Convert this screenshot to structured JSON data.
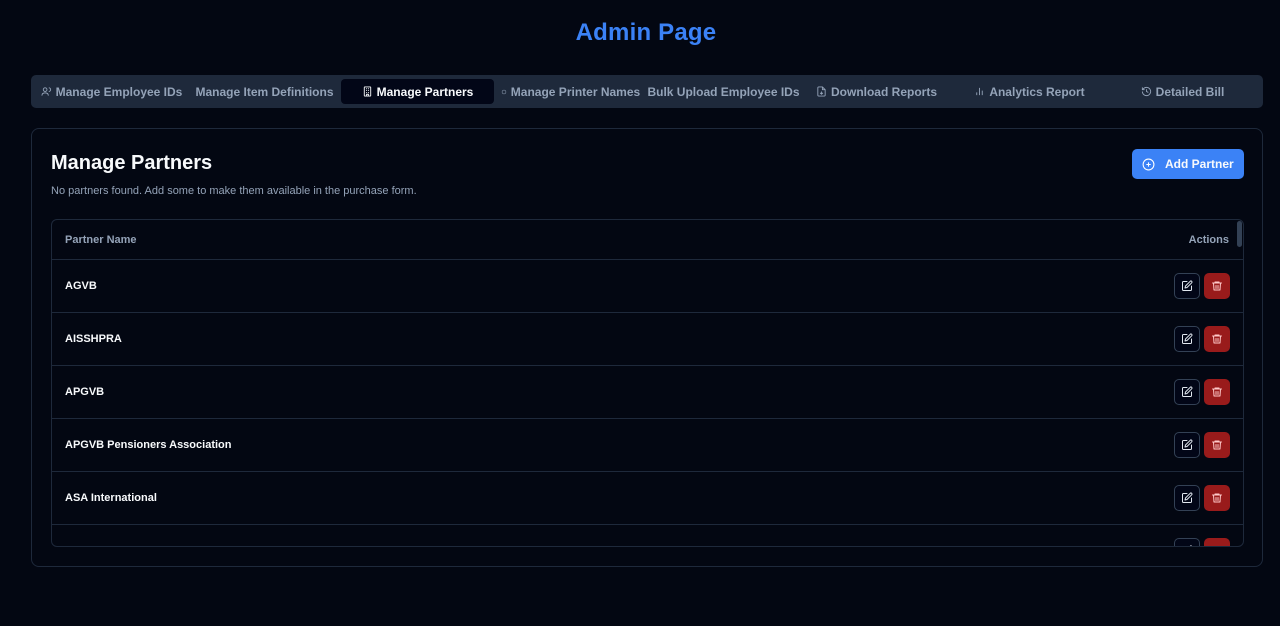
{
  "page": {
    "title": "Admin Page"
  },
  "tabs": [
    {
      "label": "Manage Employee IDs",
      "icon": "users-icon",
      "active": false
    },
    {
      "label": "Manage Item Definitions",
      "icon": "",
      "active": false
    },
    {
      "label": "Manage Partners",
      "icon": "building-icon",
      "active": true
    },
    {
      "label": "Manage Printer Names",
      "icon": "dot-icon",
      "active": false
    },
    {
      "label": "Bulk Upload Employee IDs",
      "icon": "",
      "active": false
    },
    {
      "label": "Download Reports",
      "icon": "file-download-icon",
      "active": false
    },
    {
      "label": "Analytics Report",
      "icon": "bar-chart-icon",
      "active": false
    },
    {
      "label": "Detailed Bill",
      "icon": "history-icon",
      "active": false
    }
  ],
  "section": {
    "title": "Manage Partners",
    "subtitle": "No partners found. Add some to make them available in the purchase form.",
    "add_button": "Add Partner"
  },
  "table": {
    "columns": [
      "Partner Name",
      "Actions"
    ],
    "rows": [
      {
        "name": "AGVB"
      },
      {
        "name": "AISSHPRA"
      },
      {
        "name": "APGVB"
      },
      {
        "name": "APGVB Pensioners Association"
      },
      {
        "name": "ASA International"
      },
      {
        "name": ""
      }
    ]
  },
  "colors": {
    "accent": "#3b82f6",
    "background": "#030712",
    "danger": "#991b1b"
  }
}
